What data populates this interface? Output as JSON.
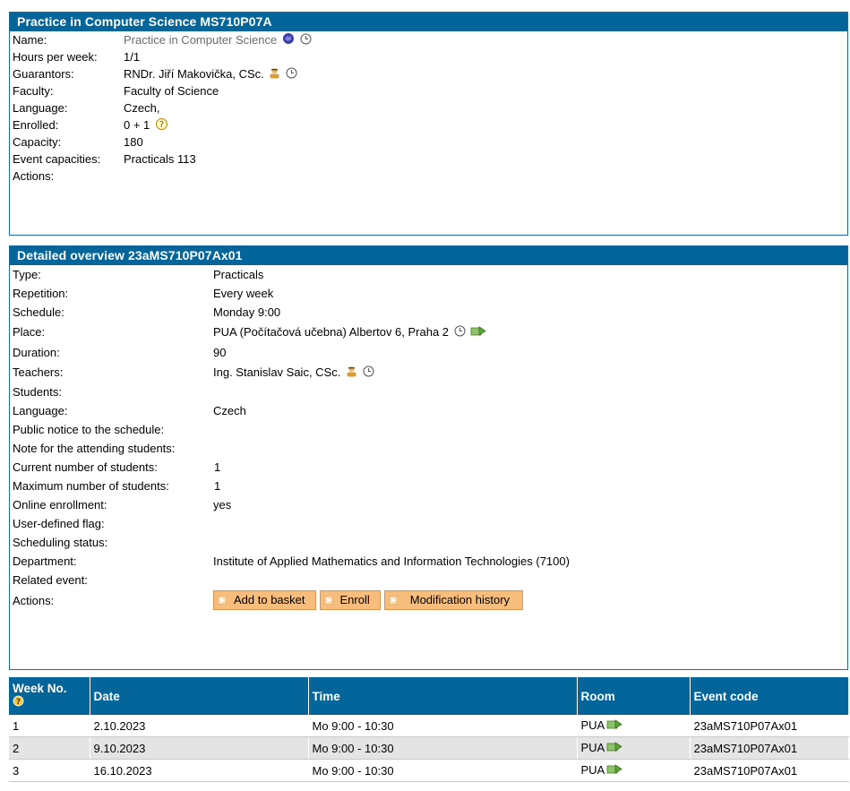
{
  "course": {
    "header": "Practice in Computer Science MS710P07A",
    "rows": [
      {
        "label": "Name:",
        "value": "Practice in Computer Science"
      },
      {
        "label": "Hours per week:",
        "value": "1/1"
      },
      {
        "label": "Guarantors:",
        "value": "RNDr. Jiří Makovička, CSc."
      },
      {
        "label": "Faculty:",
        "value": "Faculty of Science"
      },
      {
        "label": "Language:",
        "value": "Czech,"
      },
      {
        "label": "Enrolled:",
        "value": "0 + 1"
      },
      {
        "label": "Capacity:",
        "value": "180"
      },
      {
        "label": "Event capacities:",
        "value": "Practicals 113"
      },
      {
        "label": "Actions:",
        "value": ""
      }
    ]
  },
  "detail": {
    "header": "Detailed overview 23aMS710P07Ax01",
    "rows": [
      {
        "label": "Type:",
        "value": "Practicals"
      },
      {
        "label": "Repetition:",
        "value": "Every week"
      },
      {
        "label": "Schedule:",
        "value": "Monday 9:00"
      },
      {
        "label": "Place:",
        "value": "PUA (Počítačová učebna) Albertov 6, Praha 2"
      },
      {
        "label": "Duration:",
        "value": "90"
      },
      {
        "label": "Teachers:",
        "value": "Ing. Stanislav Saic, CSc."
      },
      {
        "label": "Students:",
        "value": ""
      },
      {
        "label": "Language:",
        "value": "Czech"
      },
      {
        "label": "Public notice to the schedule:",
        "value": ""
      },
      {
        "label": "Note for the attending students:",
        "value": ""
      },
      {
        "label": "Current number of students:",
        "value": "1"
      },
      {
        "label": "Maximum number of students:",
        "value": "1"
      },
      {
        "label": "Online enrollment:",
        "value": "yes"
      },
      {
        "label": "User-defined flag:",
        "value": ""
      },
      {
        "label": "Scheduling status:",
        "value": ""
      },
      {
        "label": "Department:",
        "value": "Institute of Applied Mathematics and Information Technologies (7100)"
      },
      {
        "label": "Related event:",
        "value": ""
      },
      {
        "label": "Actions:",
        "value": ""
      }
    ],
    "buttons": {
      "add_to_basket": "Add to basket",
      "enroll": "Enroll",
      "modification_history": "Modification history"
    }
  },
  "weeks": {
    "headers": {
      "week_no": "Week No.",
      "date": "Date",
      "time": "Time",
      "room": "Room",
      "event_code": "Event code"
    },
    "rows": [
      {
        "week": "1",
        "date": "2.10.2023",
        "time": "Mo 9:00 - 10:30",
        "room": "PUA",
        "code": "23aMS710P07Ax01"
      },
      {
        "week": "2",
        "date": "9.10.2023",
        "time": "Mo 9:00 - 10:30",
        "room": "PUA",
        "code": "23aMS710P07Ax01"
      },
      {
        "week": "3",
        "date": "16.10.2023",
        "time": "Mo 9:00 - 10:30",
        "room": "PUA",
        "code": "23aMS710P07Ax01"
      }
    ]
  },
  "icons": {
    "brain": "brain-icon",
    "clock": "clock-icon",
    "person": "person-icon",
    "help": "help-icon",
    "map": "map-arrow-icon",
    "triangle": "play-triangle-icon"
  },
  "colors": {
    "header_bg": "#04659b",
    "button_bg": "#f6bd7c",
    "row_alt": "#e4e4e4"
  }
}
